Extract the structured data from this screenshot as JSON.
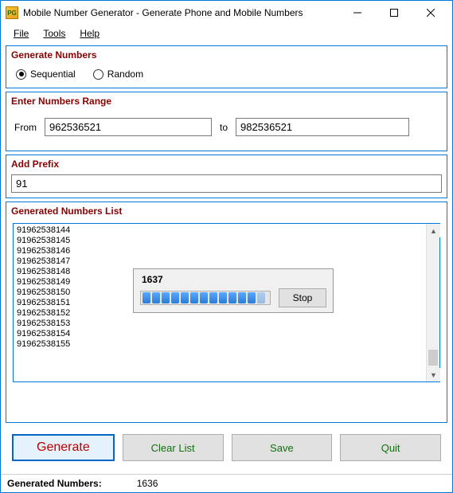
{
  "window": {
    "title": "Mobile Number Generator - Generate Phone and Mobile Numbers",
    "app_icon_text": "PG"
  },
  "menu": {
    "file": "File",
    "tools": "Tools",
    "help": "Help"
  },
  "sections": {
    "generate_numbers": {
      "title": "Generate Numbers",
      "sequential": "Sequential",
      "random": "Random",
      "selected": "sequential"
    },
    "range": {
      "title": "Enter Numbers Range",
      "from_label": "From",
      "to_label": "to",
      "from_value": "962536521",
      "to_value": "982536521"
    },
    "prefix": {
      "title": "Add Prefix",
      "value": "91"
    },
    "generated_list": {
      "title": "Generated Numbers List",
      "numbers": [
        "91962538144",
        "91962538145",
        "91962538146",
        "91962538147",
        "91962538148",
        "91962538149",
        "91962538150",
        "91962538151",
        "91962538152",
        "91962538153",
        "91962538154",
        "91962538155"
      ]
    }
  },
  "progress": {
    "count": "1637",
    "stop_label": "Stop"
  },
  "buttons": {
    "generate": "Generate",
    "clear": "Clear List",
    "save": "Save",
    "quit": "Quit"
  },
  "status": {
    "label": "Generated Numbers:",
    "value": "1636"
  }
}
